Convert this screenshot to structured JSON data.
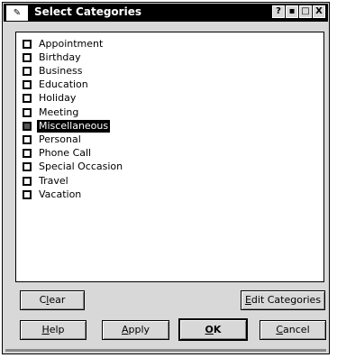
{
  "window": {
    "title": "Select Categories",
    "icon": "app-icon"
  },
  "titlebar_buttons": [
    {
      "name": "help",
      "glyph": "?"
    },
    {
      "name": "minimize",
      "glyph": "▪"
    },
    {
      "name": "maximize",
      "glyph": "□"
    },
    {
      "name": "close",
      "glyph": "X"
    }
  ],
  "categories": [
    {
      "label": "Appointment",
      "checked": false,
      "selected": false
    },
    {
      "label": "Birthday",
      "checked": false,
      "selected": false
    },
    {
      "label": "Business",
      "checked": false,
      "selected": false
    },
    {
      "label": "Education",
      "checked": false,
      "selected": false
    },
    {
      "label": "Holiday",
      "checked": false,
      "selected": false
    },
    {
      "label": "Meeting",
      "checked": false,
      "selected": false
    },
    {
      "label": "Miscellaneous",
      "checked": false,
      "selected": true
    },
    {
      "label": "Personal",
      "checked": false,
      "selected": false
    },
    {
      "label": "Phone Call",
      "checked": false,
      "selected": false
    },
    {
      "label": "Special Occasion",
      "checked": false,
      "selected": false
    },
    {
      "label": "Travel",
      "checked": false,
      "selected": false
    },
    {
      "label": "Vacation",
      "checked": false,
      "selected": false
    }
  ],
  "buttons": {
    "clear": {
      "pre": "C",
      "ul": "l",
      "post": "ear"
    },
    "edit_categories": {
      "pre": "",
      "ul": "E",
      "post": "dit Categories"
    },
    "help": {
      "pre": "",
      "ul": "H",
      "post": "elp"
    },
    "apply": {
      "pre": "",
      "ul": "A",
      "post": "pply"
    },
    "ok": {
      "pre": "",
      "ul": "O",
      "post": "K"
    },
    "cancel": {
      "pre": "",
      "ul": "C",
      "post": "ancel"
    }
  }
}
